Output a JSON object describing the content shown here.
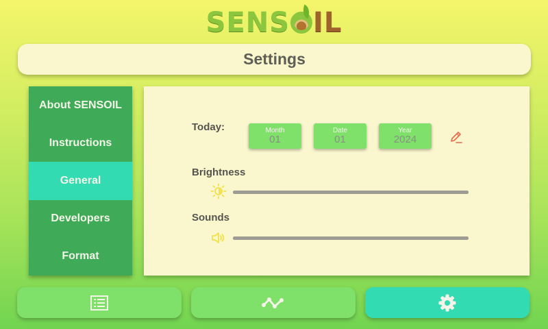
{
  "logo": {
    "part1": "SENS",
    "part2": "IL"
  },
  "header": {
    "title": "Settings"
  },
  "sidebar": {
    "items": [
      {
        "label": "About SENSOIL"
      },
      {
        "label": "Instructions"
      },
      {
        "label": "General",
        "active": true
      },
      {
        "label": "Developers"
      },
      {
        "label": "Format"
      }
    ]
  },
  "general": {
    "today_label": "Today:",
    "date": {
      "month_caption": "Month",
      "month_value": "01",
      "day_caption": "Date",
      "day_value": "01",
      "year_caption": "Year",
      "year_value": "2024"
    },
    "brightness_label": "Brightness",
    "brightness_level": 1.0,
    "sounds_label": "Sounds",
    "sounds_level": 1.0,
    "icons": {
      "edit": "pencil-icon",
      "brightness": "sun-icon",
      "sound": "speaker-icon"
    }
  },
  "bottom_nav": {
    "items": [
      {
        "icon": "list-icon",
        "active": false
      },
      {
        "icon": "chart-line-icon",
        "active": false
      },
      {
        "icon": "gear-icon",
        "active": true
      }
    ]
  },
  "colors": {
    "accent": "#33dbb2",
    "sidebar": "#3faa57",
    "nav_button": "#7fe06a",
    "panel": "#faf7cf",
    "edit_icon": "#e8694a",
    "slider_icon": "#f2e14a"
  }
}
